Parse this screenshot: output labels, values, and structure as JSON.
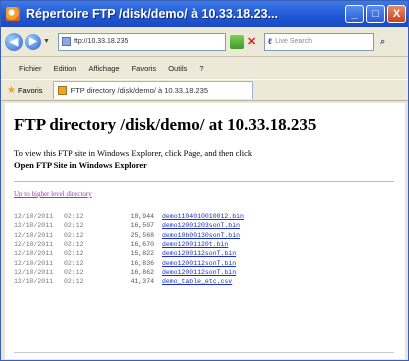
{
  "window": {
    "title": "Répertoire FTP /disk/demo/ à 10.33.18.23...",
    "min_glyph": "_",
    "max_glyph": "□",
    "close_glyph": "X"
  },
  "navbar": {
    "address": "ftp://10.33.18.235",
    "search_placeholder": "Live Search"
  },
  "menu": [
    "Fichier",
    "Edition",
    "Affichage",
    "Favoris",
    "Outils",
    "?"
  ],
  "favorites": {
    "label": "Favoris",
    "tab_title": "FTP directory /disk/demo/ à 10.33.18.235"
  },
  "page": {
    "heading": "FTP directory /disk/demo/ at 10.33.18.235",
    "intro_line1": "To view this FTP site in Windows Explorer, click Page, and then click",
    "intro_line2": "Open FTP Site in Windows Explorer",
    "parent_link": "Up to higher level directory"
  },
  "listing": [
    {
      "date": "12/10/2011",
      "time": "02:12",
      "size": "18,944",
      "name": "demo1104010010012.bin"
    },
    {
      "date": "12/10/2011",
      "time": "02:12",
      "size": "16,507",
      "name": "demo12001203sonT.bin"
    },
    {
      "date": "12/10/2011",
      "time": "02:12",
      "size": "25,568",
      "name": "demo10b00130sonT.bin"
    },
    {
      "date": "12/10/2011",
      "time": "02:12",
      "size": "16,670",
      "name": "demo12001120t.bin"
    },
    {
      "date": "12/10/2011",
      "time": "02:12",
      "size": "15,822",
      "name": "demo1200112sonT.bin"
    },
    {
      "date": "12/10/2011",
      "time": "02:12",
      "size": "16,836",
      "name": "demo1200112sonT.bin"
    },
    {
      "date": "12/10/2011",
      "time": "02:12",
      "size": "16,862",
      "name": "demo1200112sonT.bin"
    },
    {
      "date": "12/10/2011",
      "time": "02:12",
      "size": "41,374",
      "name": "demo_table_etc.csv"
    }
  ]
}
